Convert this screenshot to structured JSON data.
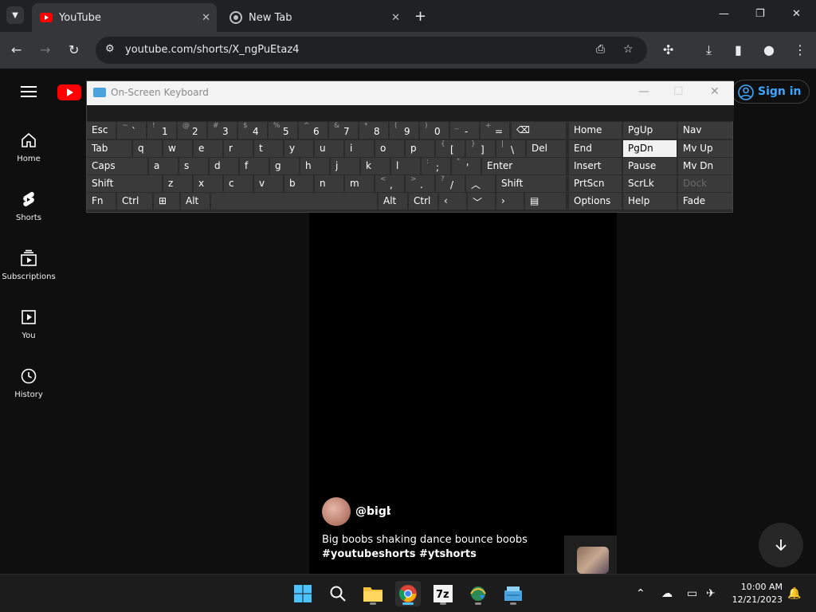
{
  "browser": {
    "tabs": [
      {
        "label": "YouTube",
        "active": true
      },
      {
        "label": "New Tab",
        "active": false
      }
    ],
    "url": "youtube.com/shorts/X_ngPuEtaz4"
  },
  "youtube": {
    "signin_label": "Sign in",
    "nav": [
      {
        "label": "Home",
        "icon": "home-icon"
      },
      {
        "label": "Shorts",
        "icon": "shorts-icon"
      },
      {
        "label": "Subscriptions",
        "icon": "subscriptions-icon"
      },
      {
        "label": "You",
        "icon": "you-icon"
      },
      {
        "label": "History",
        "icon": "history-icon"
      }
    ],
    "short": {
      "handle": "@bigbo",
      "title": "Big boobs shaking dance bounce boobs",
      "tags": "#youtubeshorts #ytshorts"
    }
  },
  "osk": {
    "title": "On-Screen Keyboard",
    "keys": {
      "esc": "Esc",
      "tab": "Tab",
      "caps": "Caps",
      "shift": "Shift",
      "fn": "Fn",
      "ctrl": "Ctrl",
      "alt": "Alt",
      "del": "Del",
      "enter": "Enter",
      "home": "Home",
      "pgup": "PgUp",
      "nav": "Nav",
      "end": "End",
      "pgdn": "PgDn",
      "mvup": "Mv Up",
      "insert": "Insert",
      "pause": "Pause",
      "mvdn": "Mv Dn",
      "prtscn": "PrtScn",
      "scrlk": "ScrLk",
      "dock": "Dock",
      "options": "Options",
      "help": "Help",
      "fade": "Fade"
    },
    "num_row": [
      {
        "s": "~",
        "m": "`"
      },
      {
        "s": "!",
        "m": "1"
      },
      {
        "s": "@",
        "m": "2"
      },
      {
        "s": "#",
        "m": "3"
      },
      {
        "s": "$",
        "m": "4"
      },
      {
        "s": "%",
        "m": "5"
      },
      {
        "s": "^",
        "m": "6"
      },
      {
        "s": "&",
        "m": "7"
      },
      {
        "s": "*",
        "m": "8"
      },
      {
        "s": "(",
        "m": "9"
      },
      {
        "s": ")",
        "m": "0"
      },
      {
        "s": "_",
        "m": "-"
      },
      {
        "s": "+",
        "m": "="
      }
    ],
    "row_q": [
      "q",
      "w",
      "e",
      "r",
      "t",
      "y",
      "u",
      "i",
      "o",
      "p"
    ],
    "row_q_sym": [
      {
        "s": "{",
        "m": "["
      },
      {
        "s": "}",
        "m": "]"
      },
      {
        "s": "|",
        "m": "\\"
      }
    ],
    "row_a": [
      "a",
      "s",
      "d",
      "f",
      "g",
      "h",
      "j",
      "k",
      "l"
    ],
    "row_a_sym": [
      {
        "s": ":",
        "m": ";"
      },
      {
        "s": "\"",
        "m": "'"
      }
    ],
    "row_z": [
      "z",
      "x",
      "c",
      "v",
      "b",
      "n",
      "m"
    ],
    "row_z_sym": [
      {
        "s": "<",
        "m": ","
      },
      {
        "s": ">",
        "m": "."
      },
      {
        "s": "?",
        "m": "/"
      }
    ]
  },
  "taskbar": {
    "time": "10:00 AM",
    "date": "12/21/2023"
  }
}
